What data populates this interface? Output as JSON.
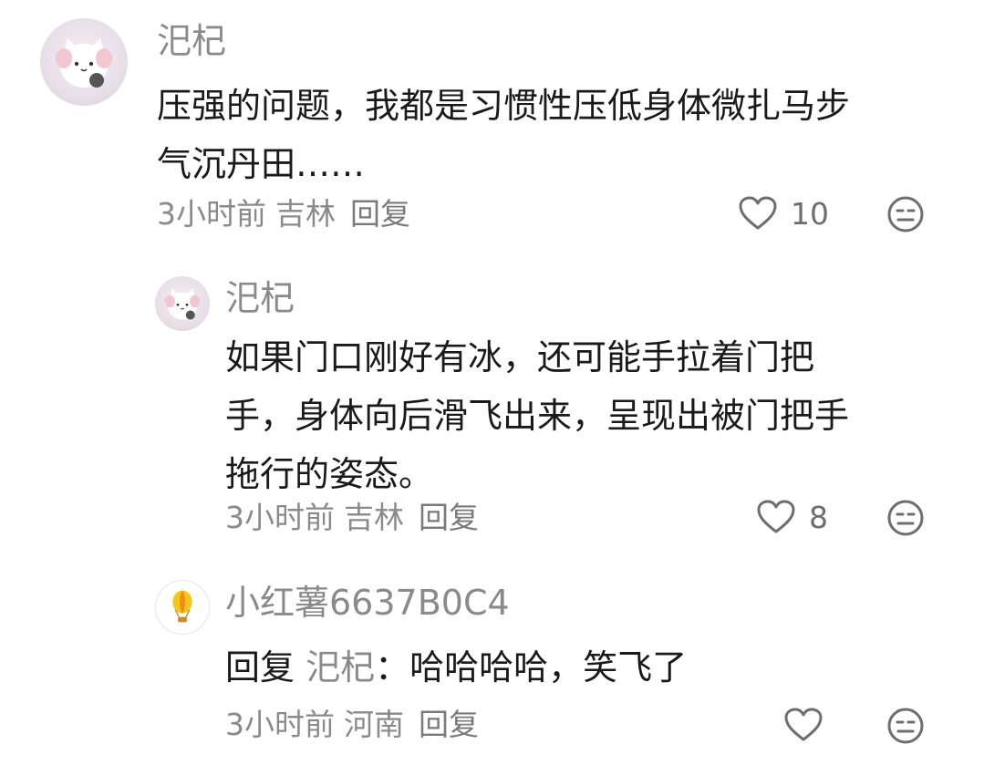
{
  "comments": [
    {
      "username": "汜杞",
      "content_lines": [
        "压强的问题，我都是习惯性压低身体微扎马步",
        "气沉丹田……"
      ],
      "time": "3小时前",
      "location": "吉林",
      "reply_label": "回复",
      "likes": "10"
    }
  ],
  "replies": [
    {
      "username": "汜杞",
      "content_lines": [
        "如果门口刚好有冰，还可能手拉着门把",
        "手，身体向后滑飞出来，呈现出被门把手",
        "拖行的姿态。"
      ],
      "time": "3小时前",
      "location": "吉林",
      "reply_label": "回复",
      "likes": "8"
    },
    {
      "username": "小红薯6637B0C4",
      "reply_prefix": "回复",
      "reply_target": "汜杞",
      "reply_sep": "：",
      "content_text": "哈哈哈哈，笑飞了",
      "time": "3小时前",
      "location": "河南",
      "reply_label": "回复",
      "likes": ""
    }
  ],
  "colors": {
    "text": "#1a1a1a",
    "muted": "#8a8a8a",
    "icon": "#6e6e6e",
    "balloon": "#f5c518"
  },
  "icons": {
    "like": "heart-outline-icon",
    "dislike": "neutral-face-icon",
    "avatar_default": "hot-air-balloon-icon"
  }
}
